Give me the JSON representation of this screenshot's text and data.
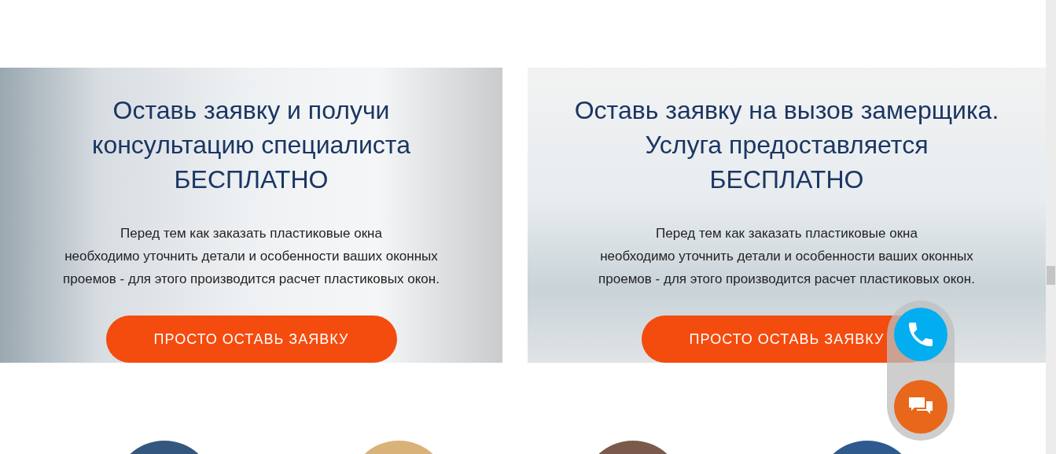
{
  "cards": [
    {
      "kind": "consultation",
      "title": "Оставь заявку и получи\nконсультацию специалиста\nБЕСПЛАТНО",
      "text": "Перед тем как заказать пластиковые окна\nнеобходимо уточнить детали и особенности ваших оконных\nпроемов - для этого производится расчет пластиковых окон.",
      "button": "ПРОСТО ОСТАВЬ ЗАЯВКУ"
    },
    {
      "kind": "measurement",
      "title": "Оставь заявку на вызов замерщика.\nУслуга предоставляется\nБЕСПЛАТНО",
      "text": "Перед тем как заказать пластиковые окна\nнеобходимо уточнить детали и особенности ваших оконных\nпроемов - для этого производится расчет пластиковых окон.",
      "button": "ПРОСТО ОСТАВЬ ЗАЯВКУ"
    }
  ]
}
